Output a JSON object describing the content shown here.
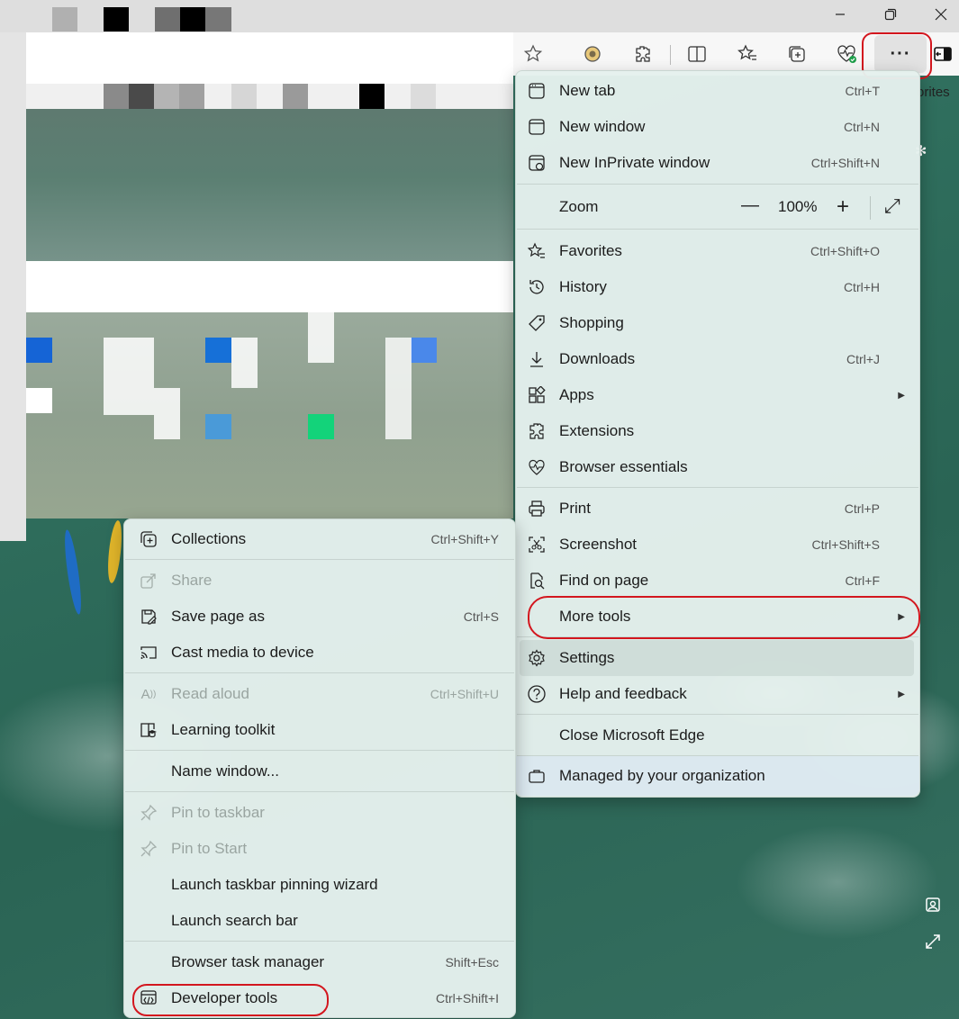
{
  "window": {
    "minimize_icon": "minimize-icon",
    "restore_icon": "restore-icon",
    "close_icon": "close-icon"
  },
  "toolbar": {
    "more_label": "···",
    "partial_text": "orites"
  },
  "main_menu": {
    "items": [
      {
        "label": "New tab",
        "shortcut": "Ctrl+T",
        "icon": "new-tab-icon"
      },
      {
        "label": "New window",
        "shortcut": "Ctrl+N",
        "icon": "new-window-icon"
      },
      {
        "label": "New InPrivate window",
        "shortcut": "Ctrl+Shift+N",
        "icon": "inprivate-icon"
      },
      {
        "label": "Zoom",
        "value": "100%",
        "minus": "—",
        "plus": "+",
        "expand": "⤢"
      },
      {
        "label": "Favorites",
        "shortcut": "Ctrl+Shift+O",
        "icon": "favorites-icon"
      },
      {
        "label": "History",
        "shortcut": "Ctrl+H",
        "icon": "history-icon"
      },
      {
        "label": "Shopping",
        "shortcut": "",
        "icon": "shopping-tag-icon"
      },
      {
        "label": "Downloads",
        "shortcut": "Ctrl+J",
        "icon": "download-icon"
      },
      {
        "label": "Apps",
        "shortcut": "",
        "icon": "apps-icon",
        "submenu": true
      },
      {
        "label": "Extensions",
        "shortcut": "",
        "icon": "extensions-icon"
      },
      {
        "label": "Browser essentials",
        "shortcut": "",
        "icon": "heart-pulse-icon"
      },
      {
        "label": "Print",
        "shortcut": "Ctrl+P",
        "icon": "print-icon"
      },
      {
        "label": "Screenshot",
        "shortcut": "Ctrl+Shift+S",
        "icon": "screenshot-icon"
      },
      {
        "label": "Find on page",
        "shortcut": "Ctrl+F",
        "icon": "find-icon"
      },
      {
        "label": "More tools",
        "shortcut": "",
        "icon": "",
        "submenu": true
      },
      {
        "label": "Settings",
        "shortcut": "",
        "icon": "gear-icon"
      },
      {
        "label": "Help and feedback",
        "shortcut": "",
        "icon": "help-icon",
        "submenu": true
      },
      {
        "label": "Close Microsoft Edge",
        "shortcut": "",
        "icon": ""
      },
      {
        "label": "Managed by your organization",
        "shortcut": "",
        "icon": "briefcase-icon"
      }
    ]
  },
  "sub_menu": {
    "items": [
      {
        "label": "Collections",
        "shortcut": "Ctrl+Shift+Y",
        "icon": "collections-icon"
      },
      {
        "label": "Share",
        "shortcut": "",
        "icon": "share-icon",
        "disabled": true
      },
      {
        "label": "Save page as",
        "shortcut": "Ctrl+S",
        "icon": "save-icon"
      },
      {
        "label": "Cast media to device",
        "shortcut": "",
        "icon": "cast-icon"
      },
      {
        "label": "Read aloud",
        "shortcut": "Ctrl+Shift+U",
        "icon": "read-aloud-icon",
        "disabled": true
      },
      {
        "label": "Learning toolkit",
        "shortcut": "",
        "icon": "learning-icon"
      },
      {
        "label": "Name window...",
        "shortcut": "",
        "icon": ""
      },
      {
        "label": "Pin to taskbar",
        "shortcut": "",
        "icon": "pin-icon",
        "disabled": true
      },
      {
        "label": "Pin to Start",
        "shortcut": "",
        "icon": "pin-icon",
        "disabled": true
      },
      {
        "label": "Launch taskbar pinning wizard",
        "shortcut": "",
        "icon": ""
      },
      {
        "label": "Launch search bar",
        "shortcut": "",
        "icon": ""
      },
      {
        "label": "Browser task manager",
        "shortcut": "Shift+Esc",
        "icon": ""
      },
      {
        "label": "Developer tools",
        "shortcut": "Ctrl+Shift+I",
        "icon": "developer-tools-icon"
      }
    ]
  }
}
